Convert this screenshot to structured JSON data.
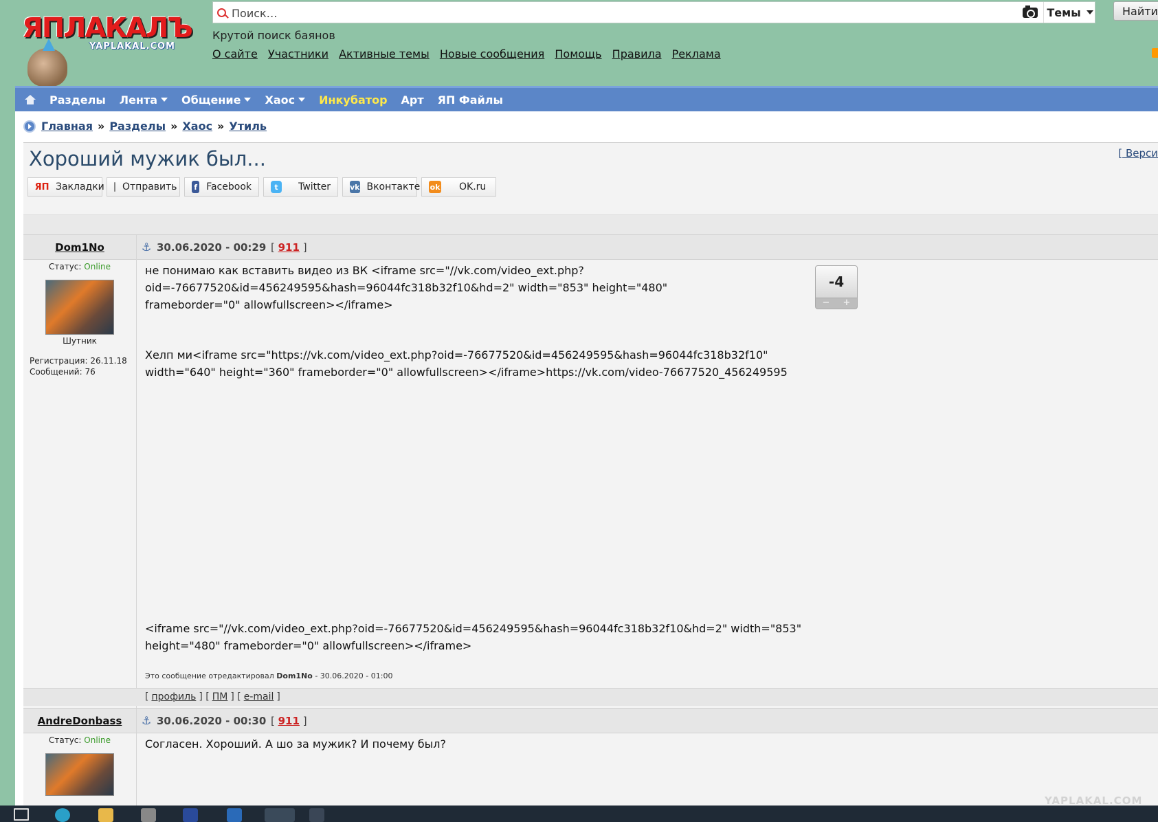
{
  "site": {
    "logo_text": "ЯПЛАКАЛЪ",
    "logo_sub": "YAPLAKAL.COM",
    "tagline": "Крутой поиск баянов",
    "watermark": "YAPLAKAL.COM"
  },
  "search": {
    "placeholder": "Поиск…",
    "themes_label": "Темы",
    "find_label": "Найти"
  },
  "header_links": [
    "О сайте",
    "Участники",
    "Активные темы",
    "Новые сообщения",
    "Помощь",
    "Правила",
    "Реклама"
  ],
  "nav": {
    "items": [
      {
        "label": "Разделы",
        "dropdown": false
      },
      {
        "label": "Лента",
        "dropdown": true
      },
      {
        "label": "Общение",
        "dropdown": true
      },
      {
        "label": "Хаос",
        "dropdown": true
      },
      {
        "label": "Инкубатор",
        "dropdown": false,
        "highlight": "#ffe94a"
      },
      {
        "label": "Арт",
        "dropdown": false
      },
      {
        "label": "ЯП Файлы",
        "dropdown": false
      }
    ]
  },
  "breadcrumb": [
    "Главная",
    "Разделы",
    "Хаос",
    "Утиль"
  ],
  "topic": {
    "title": "Хороший мужик был...",
    "version_label": "[ Верси"
  },
  "share": [
    {
      "label": "Закладки",
      "icon": "yap-icon"
    },
    {
      "label": "Отправить",
      "icon": "mail-icon"
    },
    {
      "label": "Facebook",
      "icon": "facebook-icon"
    },
    {
      "label": "Twitter",
      "icon": "twitter-icon"
    },
    {
      "label": "Вконтакте",
      "icon": "vk-icon"
    },
    {
      "label": "OK.ru",
      "icon": "ok-icon"
    }
  ],
  "posts": [
    {
      "author": "Dom1No",
      "date": "30.06.2020 - 00:29",
      "number": "911",
      "status_label": "Статус:",
      "status_value": "Online",
      "rank": "Шутник",
      "registration": "Регистрация: 26.11.18",
      "messages": "Сообщений: 76",
      "body1": "не понимаю как вставить видео из ВК <iframe src=\"//vk.com/video_ext.php?oid=-76677520&id=456249595&hash=96044fc318b32f10&hd=2\" width=\"853\" height=\"480\" frameborder=\"0\" allowfullscreen></iframe>",
      "body2": "Хелп ми<iframe src=\"https://vk.com/video_ext.php?oid=-76677520&id=456249595&hash=96044fc318b32f10\" width=\"640\" height=\"360\" frameborder=\"0\" allowfullscreen></iframe>https://vk.com/video-76677520_456249595",
      "body3": "<iframe src=\"//vk.com/video_ext.php?oid=-76677520&id=456249595&hash=96044fc318b32f10&hd=2\" width=\"853\" height=\"480\" frameborder=\"0\" allowfullscreen></iframe>",
      "rating": "-4",
      "rating_minus": "−",
      "rating_plus": "+",
      "edit_prefix": "Это сообщение отредактировал",
      "edit_author": "Dom1No",
      "edit_suffix": "- 30.06.2020 - 01:00",
      "foot_links": [
        "профиль",
        "ПМ",
        "e-mail"
      ]
    },
    {
      "author": "AndreDonbass",
      "date": "30.06.2020 - 00:30",
      "number": "911",
      "status_label": "Статус:",
      "status_value": "Online",
      "body1": "Согласен. Хороший. А шо за мужик? И почему был?"
    }
  ]
}
